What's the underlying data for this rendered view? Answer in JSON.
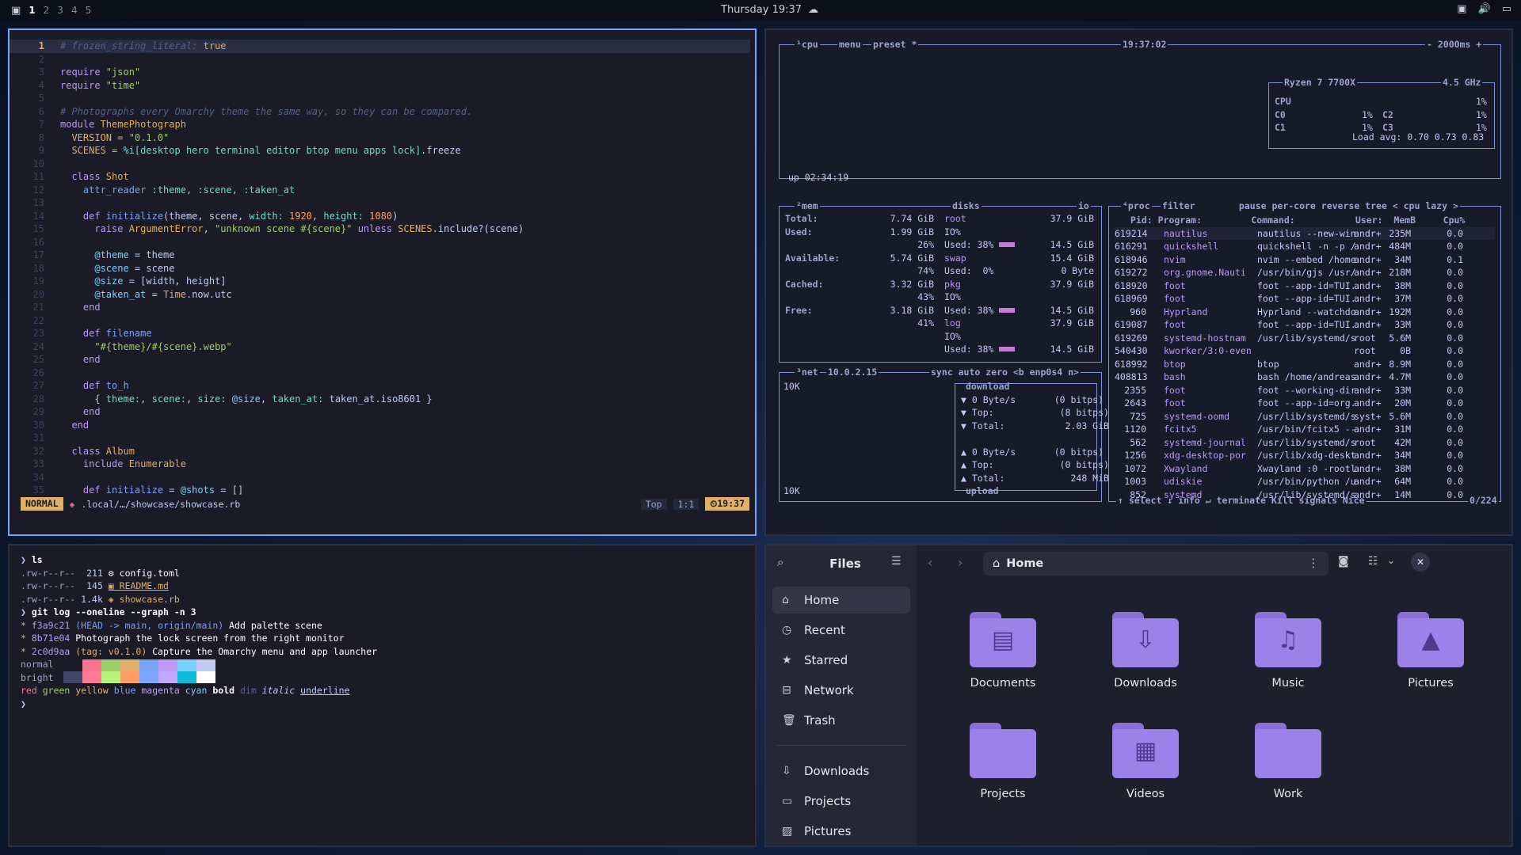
{
  "topbar": {
    "workspaces": [
      "1",
      "2",
      "3",
      "4",
      "5"
    ],
    "active": "1",
    "clock": "Thursday 19:37"
  },
  "editor": {
    "lines": [
      [
        {
          "t": "# frozen_string_literal: ",
          "c": "c"
        },
        {
          "t": "true",
          "c": "cn"
        }
      ],
      [],
      [
        {
          "t": "require ",
          "c": "k"
        },
        {
          "t": "\"json\"",
          "c": "s"
        }
      ],
      [
        {
          "t": "require ",
          "c": "k"
        },
        {
          "t": "\"time\"",
          "c": "s"
        }
      ],
      [],
      [
        {
          "t": "# Photographs every Omarchy theme the same way, so they can be compared.",
          "c": "c"
        }
      ],
      [
        {
          "t": "module ",
          "c": "k"
        },
        {
          "t": "ThemePhotograph",
          "c": "cn"
        }
      ],
      [
        {
          "t": "  VERSION = ",
          "c": "cn"
        },
        {
          "t": "\"0.1.0\"",
          "c": "s"
        }
      ],
      [
        {
          "t": "  SCENES = ",
          "c": "cn"
        },
        {
          "t": "%i[desktop hero terminal editor btop menu apps lock]",
          "c": "sy"
        },
        {
          "t": ".freeze",
          "c": ""
        }
      ],
      [],
      [
        {
          "t": "  class ",
          "c": "k"
        },
        {
          "t": "Shot",
          "c": "cn"
        }
      ],
      [
        {
          "t": "    attr_reader ",
          "c": "fn"
        },
        {
          "t": ":theme, :scene, :taken_at",
          "c": "sy"
        }
      ],
      [],
      [
        {
          "t": "    def ",
          "c": "k"
        },
        {
          "t": "initialize",
          "c": "fn"
        },
        {
          "t": "(theme, scene, ",
          "c": ""
        },
        {
          "t": "width: ",
          "c": "sy"
        },
        {
          "t": "1920",
          "c": "n"
        },
        {
          "t": ", ",
          "c": ""
        },
        {
          "t": "height: ",
          "c": "sy"
        },
        {
          "t": "1080",
          "c": "n"
        },
        {
          "t": ")",
          "c": ""
        }
      ],
      [
        {
          "t": "      raise ",
          "c": "k"
        },
        {
          "t": "ArgumentError",
          "c": "cn"
        },
        {
          "t": ", ",
          "c": ""
        },
        {
          "t": "\"unknown scene #{scene}\"",
          "c": "s"
        },
        {
          "t": " unless ",
          "c": "k"
        },
        {
          "t": "SCENES",
          "c": "cn"
        },
        {
          "t": ".include?(scene)",
          "c": ""
        }
      ],
      [],
      [
        {
          "t": "      @theme",
          "c": "iv"
        },
        {
          "t": " = theme",
          "c": ""
        }
      ],
      [
        {
          "t": "      @scene",
          "c": "iv"
        },
        {
          "t": " = scene",
          "c": ""
        }
      ],
      [
        {
          "t": "      @size",
          "c": "iv"
        },
        {
          "t": " = [width, height]",
          "c": ""
        }
      ],
      [
        {
          "t": "      @taken_at",
          "c": "iv"
        },
        {
          "t": " = ",
          "c": ""
        },
        {
          "t": "Time",
          "c": "cn"
        },
        {
          "t": ".now.utc",
          "c": ""
        }
      ],
      [
        {
          "t": "    end",
          "c": "k"
        }
      ],
      [],
      [
        {
          "t": "    def ",
          "c": "k"
        },
        {
          "t": "filename",
          "c": "fn"
        }
      ],
      [
        {
          "t": "      \"#{theme}/#{scene}",
          "c": "s"
        },
        {
          "t": ".webp\"",
          "c": "s"
        }
      ],
      [
        {
          "t": "    end",
          "c": "k"
        }
      ],
      [],
      [
        {
          "t": "    def ",
          "c": "k"
        },
        {
          "t": "to_h",
          "c": "fn"
        }
      ],
      [
        {
          "t": "      { ",
          "c": ""
        },
        {
          "t": "theme:",
          "c": "sy"
        },
        {
          "t": ", ",
          "c": ""
        },
        {
          "t": "scene:",
          "c": "sy"
        },
        {
          "t": ", ",
          "c": ""
        },
        {
          "t": "size: ",
          "c": "sy"
        },
        {
          "t": "@size",
          "c": "iv"
        },
        {
          "t": ", ",
          "c": ""
        },
        {
          "t": "taken_at: ",
          "c": "sy"
        },
        {
          "t": "taken_at.iso8601 }",
          "c": ""
        }
      ],
      [
        {
          "t": "    end",
          "c": "k"
        }
      ],
      [
        {
          "t": "  end",
          "c": "k"
        }
      ],
      [],
      [
        {
          "t": "  class ",
          "c": "k"
        },
        {
          "t": "Album",
          "c": "cn"
        }
      ],
      [
        {
          "t": "    include ",
          "c": "k"
        },
        {
          "t": "Enumerable",
          "c": "cn"
        }
      ],
      [],
      [
        {
          "t": "    def ",
          "c": "k"
        },
        {
          "t": "initialize",
          "c": "fn"
        },
        {
          "t": " = ",
          "c": ""
        },
        {
          "t": "@shots",
          "c": "iv"
        },
        {
          "t": " = []",
          "c": ""
        }
      ]
    ],
    "mode": "NORMAL",
    "path": ".local/…/showcase/showcase.rb",
    "pos_top": "Top",
    "pos": "1:1",
    "time": "19:37"
  },
  "btop": {
    "cpu_title": "¹cpu",
    "cpu_menu": "menu",
    "cpu_preset": "preset *",
    "cpu_clock": "19:37:02",
    "cpu_interval": "- 2000ms +",
    "cpu_model": "Ryzen 7 7700X",
    "cpu_freq": "4.5 GHz",
    "cpu_rows": [
      [
        "CPU",
        "1%"
      ],
      [
        "C0",
        "1%",
        "C2",
        "1%"
      ],
      [
        "C1",
        "1%",
        "C3",
        "1%"
      ]
    ],
    "load": "Load avg: 0.70 0.73 0.83",
    "uptime": "up 02:34:19",
    "mem_title": "²mem",
    "disks_title": "disks",
    "io_title": "io",
    "mem_rows": [
      [
        "Total:",
        "7.74 GiB"
      ],
      [
        "Used:",
        "1.99 GiB"
      ],
      [
        "",
        "26%"
      ],
      [
        "Available:",
        "5.74 GiB"
      ],
      [
        "",
        "74%"
      ],
      [
        "Cached:",
        "3.32 GiB"
      ],
      [
        "",
        "43%"
      ],
      [
        "Free:",
        "3.18 GiB"
      ],
      [
        "",
        "41%"
      ]
    ],
    "disk_rows": [
      [
        "root",
        "37.9 GiB"
      ],
      [
        "IO%",
        ""
      ],
      [
        "Used: 38%",
        "14.5 GiB"
      ],
      [
        "swap",
        "15.4 GiB"
      ],
      [
        "Used:  0%",
        "0 Byte"
      ],
      [
        "pkg",
        "37.9 GiB"
      ],
      [
        "IO%",
        ""
      ],
      [
        "Used: 38%",
        "14.5 GiB"
      ],
      [
        "log",
        "37.9 GiB"
      ],
      [
        "IO%",
        ""
      ],
      [
        "Used: 38%",
        "14.5 GiB"
      ]
    ],
    "net_title": "³net",
    "net_ip": "10.0.2.15",
    "net_opts": "sync auto zero <b enp0s4 n>",
    "net_scale": "10K",
    "net_rows": [
      "download",
      "▼ 0 Byte/s       (0 bitps)",
      "▼ Top:            (8 bitps)",
      "▼ Total:           2.03 GiB",
      "",
      "▲ 0 Byte/s       (0 bitps)",
      "▲ Top:            (0 bitps)",
      "▲ Total:            248 MiB",
      "upload"
    ],
    "proc_title": "⁴proc",
    "proc_opts": "filter        pause per-core reverse tree < cpu lazy >",
    "proc_header": "Pid: Program:         Command:           User:  MemB     Cpu%",
    "procs": [
      [
        "619214",
        "nautilus",
        "nautilus --new-win",
        "andr+",
        "235M",
        "0.0"
      ],
      [
        "616291",
        "quickshell",
        "quickshell -n -p /",
        "andr+",
        "484M",
        "0.0"
      ],
      [
        "618946",
        "nvim",
        "nvim --embed /home",
        "andr+",
        "34M",
        "0.1"
      ],
      [
        "619272",
        "org.gnome.Nauti",
        "/usr/bin/gjs /usr/",
        "andr+",
        "218M",
        "0.0"
      ],
      [
        "618920",
        "foot",
        "foot --app-id=TUI.",
        "andr+",
        "38M",
        "0.0"
      ],
      [
        "618969",
        "foot",
        "foot --app-id=TUI.",
        "andr+",
        "37M",
        "0.0"
      ],
      [
        "960",
        "Hyprland",
        "Hyprland --watchdo",
        "andr+",
        "192M",
        "0.0"
      ],
      [
        "619087",
        "foot",
        "foot --app-id=TUI.",
        "andr+",
        "33M",
        "0.0"
      ],
      [
        "619269",
        "systemd-hostnam",
        "/usr/lib/systemd/s",
        "root",
        "5.6M",
        "0.0"
      ],
      [
        "540430",
        "kworker/3:0-even",
        "",
        "root",
        "0B",
        "0.0"
      ],
      [
        "618992",
        "btop",
        "btop",
        "andr+",
        "8.9M",
        "0.0"
      ],
      [
        "408813",
        "bash",
        "bash /home/andreas",
        "andr+",
        "4.7M",
        "0.0"
      ],
      [
        "2355",
        "foot",
        "foot --working-dir",
        "andr+",
        "33M",
        "0.0"
      ],
      [
        "2643",
        "foot",
        "foot --app-id=org.",
        "andr+",
        "20M",
        "0.0"
      ],
      [
        "725",
        "systemd-oomd",
        "/usr/lib/systemd/s",
        "syst+",
        "5.6M",
        "0.0"
      ],
      [
        "1120",
        "fcitx5",
        "/usr/bin/fcitx5 --",
        "andr+",
        "31M",
        "0.0"
      ],
      [
        "562",
        "systemd-journal",
        "/usr/lib/systemd/s",
        "root",
        "42M",
        "0.0"
      ],
      [
        "1256",
        "xdg-desktop-por",
        "/usr/lib/xdg-deskt",
        "andr+",
        "34M",
        "0.0"
      ],
      [
        "1072",
        "Xwayland",
        "Xwayland :0 -rootl",
        "andr+",
        "38M",
        "0.0"
      ],
      [
        "1003",
        "udiskie",
        "/usr/bin/python /u",
        "andr+",
        "64M",
        "0.0"
      ],
      [
        "852",
        "systemd",
        "/usr/lib/systemd/s",
        "andr+",
        "14M",
        "0.0"
      ]
    ],
    "proc_footer": "↑ select ↓ info ↵ terminate Kill signals Nice",
    "proc_count": "0/224"
  },
  "term": {
    "lines": [
      [
        {
          "t": "❯ ",
          "c": "#c0caf5"
        },
        {
          "t": "ls",
          "c": "#ffffff",
          "b": true
        }
      ],
      [
        {
          "t": ".rw-r--r--  ",
          "c": "#9aa5ce"
        },
        {
          "t": "211 ",
          "c": "#c0caf5"
        },
        {
          "t": "⚙ config.toml",
          "c": "#ffffff"
        }
      ],
      [
        {
          "t": ".rw-r--r--  ",
          "c": "#9aa5ce"
        },
        {
          "t": "145 ",
          "c": "#c0caf5"
        },
        {
          "t": "▣ README.md",
          "c": "#e0af68",
          "u": true
        }
      ],
      [
        {
          "t": ".rw-r--r-- ",
          "c": "#9aa5ce"
        },
        {
          "t": "1.4k ",
          "c": "#c0caf5"
        },
        {
          "t": "◈ showcase.rb",
          "c": "#e0af68"
        }
      ],
      [
        {
          "t": "❯ ",
          "c": "#c0caf5"
        },
        {
          "t": "git log --oneline --graph -n 3",
          "c": "#ffffff",
          "b": true
        }
      ],
      [
        {
          "t": "* ",
          "c": "#e0af68"
        },
        {
          "t": "f3a9c21 ",
          "c": "#bb9af7"
        },
        {
          "t": "(HEAD -> main, origin/main) ",
          "c": "#7aa2f7"
        },
        {
          "t": "Add palette scene",
          "c": "#ffffff"
        }
      ],
      [
        {
          "t": "* ",
          "c": "#e0af68"
        },
        {
          "t": "8b71e04 ",
          "c": "#bb9af7"
        },
        {
          "t": "Photograph the lock screen from the right monitor",
          "c": "#ffffff"
        }
      ],
      [
        {
          "t": "* ",
          "c": "#e0af68"
        },
        {
          "t": "2c0d9aa ",
          "c": "#bb9af7"
        },
        {
          "t": "(tag: v0.1.0) ",
          "c": "#e0af68"
        },
        {
          "t": "Capture the Omarchy menu and app launcher",
          "c": "#ffffff"
        }
      ],
      [
        {
          "t": "normal",
          "c": "#9aa5ce"
        }
      ],
      [
        {
          "t": "bright",
          "c": "#9aa5ce"
        }
      ],
      [
        {
          "t": "red ",
          "c": "#f7768e"
        },
        {
          "t": "green ",
          "c": "#9ece6a"
        },
        {
          "t": "yellow ",
          "c": "#e0af68"
        },
        {
          "t": "blue ",
          "c": "#7aa2f7"
        },
        {
          "t": "magenta ",
          "c": "#bb9af7"
        },
        {
          "t": "cyan ",
          "c": "#7dcfff"
        },
        {
          "t": "bold ",
          "c": "#ffffff",
          "b": true
        },
        {
          "t": "dim ",
          "c": "#565f89"
        },
        {
          "t": "italic ",
          "c": "#c0caf5",
          "i": true
        },
        {
          "t": "underline",
          "c": "#c0caf5",
          "u": true
        }
      ],
      [
        {
          "t": "❯",
          "c": "#c0caf5"
        }
      ]
    ],
    "palette_normal": [
      "#f7768e",
      "#9ece6a",
      "#e0af68",
      "#7aa2f7",
      "#bb9af7",
      "#7dcfff",
      "#c0caf5"
    ],
    "palette_bright": [
      "#414868",
      "#ff7a93",
      "#b9f27c",
      "#ff9e64",
      "#7da6ff",
      "#c3a6ff",
      "#0db9d7",
      "#ffffff"
    ]
  },
  "files": {
    "title": "Files",
    "location": "Home",
    "sidebar": [
      {
        "label": "Home",
        "icon": "⌂",
        "active": true
      },
      {
        "label": "Recent",
        "icon": "◷"
      },
      {
        "label": "Starred",
        "icon": "★"
      },
      {
        "label": "Network",
        "icon": "⊟"
      },
      {
        "label": "Trash",
        "icon": "🗑"
      },
      {
        "label": "Downloads",
        "icon": "⇩"
      },
      {
        "label": "Projects",
        "icon": "▭"
      },
      {
        "label": "Pictures",
        "icon": "▨"
      }
    ],
    "items": [
      {
        "label": "Documents",
        "glyph": "▤"
      },
      {
        "label": "Downloads",
        "glyph": "⇩"
      },
      {
        "label": "Music",
        "glyph": "♫"
      },
      {
        "label": "Pictures",
        "glyph": "▲"
      },
      {
        "label": "Projects",
        "glyph": ""
      },
      {
        "label": "Videos",
        "glyph": "▦"
      },
      {
        "label": "Work",
        "glyph": ""
      }
    ]
  }
}
